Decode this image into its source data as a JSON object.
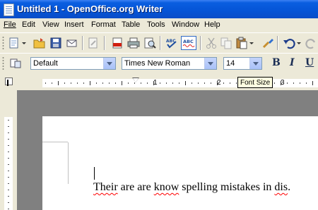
{
  "window": {
    "title": "Untitled 1 - OpenOffice.org Writer"
  },
  "menubar": {
    "items": [
      {
        "u": "F",
        "rest": "ile"
      },
      {
        "u": "E",
        "rest": "dit"
      },
      {
        "u": "V",
        "rest": "iew"
      },
      {
        "u": "I",
        "rest": "nsert"
      },
      {
        "u": "",
        "rest": "F",
        "after": "ormat",
        "mid_u": "o"
      },
      {
        "u": "",
        "rest": "T",
        "after": "able",
        "mid_u": "a"
      },
      {
        "u": "T",
        "rest": "ools"
      },
      {
        "u": "W",
        "rest": "indow"
      },
      {
        "u": "H",
        "rest": "elp"
      }
    ],
    "labels": [
      "File",
      "Edit",
      "View",
      "Insert",
      "Format",
      "Table",
      "Tools",
      "Window",
      "Help"
    ]
  },
  "formatting": {
    "paragraph_style": "Default",
    "font_name": "Times New Roman",
    "font_size": "14",
    "bold_label": "B",
    "italic_label": "I",
    "underline_label": "U"
  },
  "tooltip": {
    "text": "Font Size"
  },
  "ruler": {
    "numbers": [
      "1",
      "2",
      "3"
    ]
  },
  "document": {
    "words": [
      {
        "text": "Their",
        "misspelled": true
      },
      {
        "text": " are are ",
        "misspelled": false
      },
      {
        "text": "know",
        "misspelled": true
      },
      {
        "text": " spelling mistakes in ",
        "misspelled": false
      },
      {
        "text": "dis",
        "misspelled": true
      },
      {
        "text": ".",
        "misspelled": false
      }
    ]
  },
  "colors": {
    "title_bar": "#0a5ee0",
    "toolbar_bg": "#ece9d8",
    "spell_error": "#ff0000",
    "canvas": "#808080"
  },
  "icons": {
    "toolbar1": [
      "new-document-icon",
      "open-folder-icon",
      "save-icon",
      "email-icon",
      "edit-file-icon",
      "export-pdf-icon",
      "print-icon",
      "page-preview-icon",
      "spellcheck-icon",
      "autospellcheck-icon",
      "cut-icon",
      "copy-icon",
      "paste-icon",
      "format-paintbrush-icon",
      "undo-icon",
      "redo-icon"
    ]
  }
}
